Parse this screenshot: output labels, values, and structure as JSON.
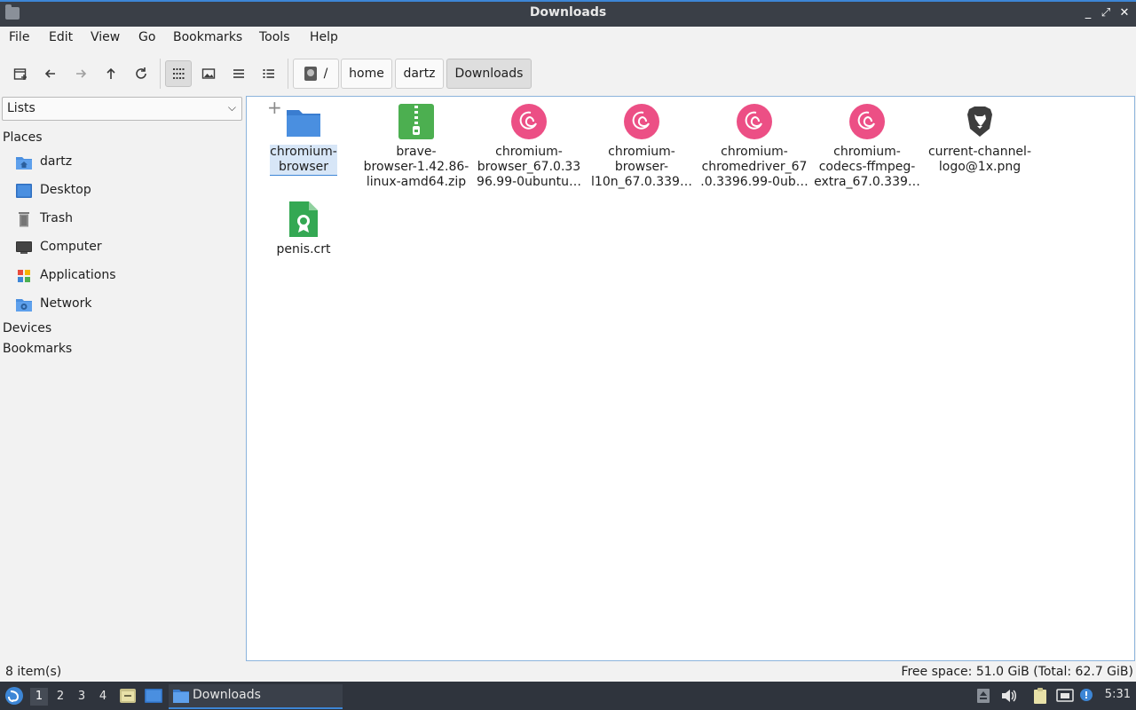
{
  "window": {
    "title": "Downloads",
    "controls": [
      "_",
      "⤢",
      "✕"
    ]
  },
  "menu": [
    "File",
    "Edit",
    "View",
    "Go",
    "Bookmarks",
    "Tools",
    "Help"
  ],
  "toolbar": {
    "icons": [
      "new-tab-icon",
      "back-arrow-icon",
      "forward-arrow-icon",
      "up-arrow-icon",
      "reload-icon",
      "icon-view-icon",
      "thumbnail-view-icon",
      "compact-view-icon",
      "detailed-list-view-icon"
    ]
  },
  "path": {
    "root_label": "/",
    "crumbs": [
      "home",
      "dartz",
      "Downloads"
    ]
  },
  "side": {
    "mode": "Lists",
    "places_header": "Places",
    "places": [
      "dartz",
      "Desktop",
      "Trash",
      "Computer",
      "Applications",
      "Network"
    ],
    "devices_header": "Devices",
    "bookmarks_header": "Bookmarks"
  },
  "files": [
    {
      "line1": "chromium-",
      "line2": "browser",
      "line3": "",
      "type": "folder",
      "selected": true
    },
    {
      "line1": "brave-",
      "line2": "browser-1.42.86-",
      "line3": "linux-amd64.zip",
      "type": "archive",
      "selected": false
    },
    {
      "line1": "chromium-",
      "line2": "browser_67.0.33",
      "line3": "96.99-0ubuntu…",
      "type": "debian",
      "selected": false
    },
    {
      "line1": "chromium-",
      "line2": "browser-",
      "line3": "l10n_67.0.339…",
      "type": "debian",
      "selected": false
    },
    {
      "line1": "chromium-",
      "line2": "chromedriver_67",
      "line3": ".0.3396.99-0ub…",
      "type": "debian",
      "selected": false
    },
    {
      "line1": "chromium-",
      "line2": "codecs-ffmpeg-",
      "line3": "extra_67.0.339…",
      "type": "debian",
      "selected": false
    },
    {
      "line1": "current-channel-",
      "line2": "logo@1x.png",
      "line3": "",
      "type": "brave-logo",
      "selected": false
    },
    {
      "line1": "penis.crt",
      "line2": "",
      "line3": "",
      "type": "certificate",
      "selected": false
    }
  ],
  "status": {
    "count": "8 item(s)",
    "free": "Free space: 51.0 GiB (Total: 62.7 GiB)"
  },
  "taskbar": {
    "workspaces": [
      "1",
      "2",
      "3",
      "4"
    ],
    "task_label": "Downloads",
    "clock": "5:31"
  },
  "colors": {
    "accent": "#3d86d6",
    "folder": "#4a8fe0",
    "debian": "#ec4f85",
    "archive": "#4caf50",
    "cert": "#34a853"
  }
}
